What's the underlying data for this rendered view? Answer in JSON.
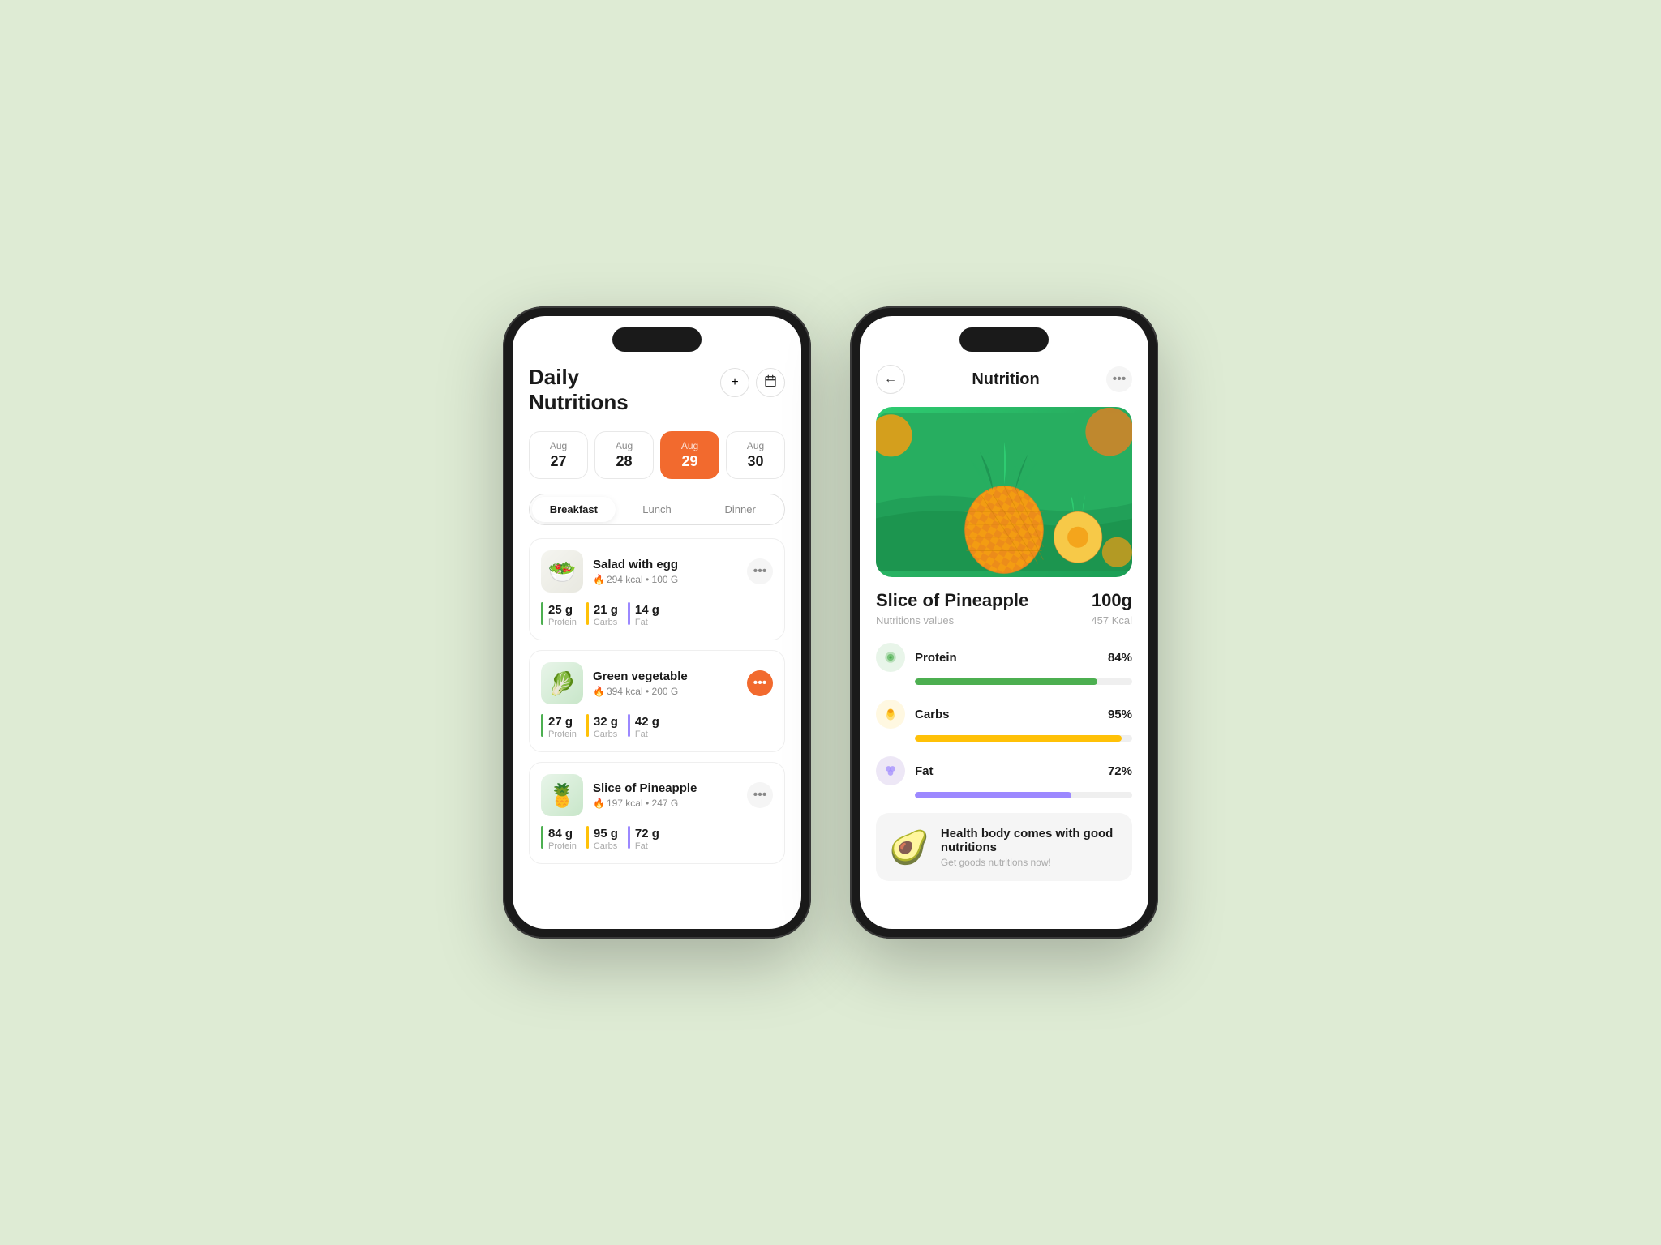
{
  "background": "#deebd4",
  "phone1": {
    "title": "Daily\nNutritions",
    "add_button": "+",
    "calendar_button": "📅",
    "dates": [
      {
        "month": "Aug",
        "day": "27",
        "active": false
      },
      {
        "month": "Aug",
        "day": "28",
        "active": false
      },
      {
        "month": "Aug",
        "day": "29",
        "active": true
      },
      {
        "month": "Aug",
        "day": "30",
        "active": false
      }
    ],
    "tabs": [
      {
        "label": "Breakfast",
        "active": true
      },
      {
        "label": "Lunch",
        "active": false
      },
      {
        "label": "Dinner",
        "active": false
      }
    ],
    "foods": [
      {
        "name": "Salad with egg",
        "kcal": "294 kcal",
        "weight": "100 G",
        "emoji": "🥗",
        "more_active": false,
        "nutrition": [
          {
            "value": "25 g",
            "label": "Protein",
            "color": "#4caf50"
          },
          {
            "value": "21 g",
            "label": "Carbs",
            "color": "#ffc107"
          },
          {
            "value": "14 g",
            "label": "Fat",
            "color": "#9c88ff"
          }
        ]
      },
      {
        "name": "Green vegetable",
        "kcal": "394 kcal",
        "weight": "200 G",
        "emoji": "🥬",
        "more_active": true,
        "nutrition": [
          {
            "value": "27 g",
            "label": "Protein",
            "color": "#4caf50"
          },
          {
            "value": "32 g",
            "label": "Carbs",
            "color": "#ffc107"
          },
          {
            "value": "42 g",
            "label": "Fat",
            "color": "#9c88ff"
          }
        ]
      },
      {
        "name": "Slice of Pineapple",
        "kcal": "197 kcal",
        "weight": "247 G",
        "emoji": "🍍",
        "more_active": false,
        "nutrition": [
          {
            "value": "84 g",
            "label": "Protein",
            "color": "#4caf50"
          },
          {
            "value": "95 g",
            "label": "Carbs",
            "color": "#ffc107"
          },
          {
            "value": "72 g",
            "label": "Fat",
            "color": "#9c88ff"
          }
        ]
      }
    ]
  },
  "phone2": {
    "title": "Nutrition",
    "back_label": "←",
    "more_label": "•••",
    "item_name": "Slice of Pineapple",
    "item_weight": "100g",
    "item_desc": "Nutritions values",
    "item_kcal": "457 Kcal",
    "nutrition_items": [
      {
        "label": "Protein",
        "pct": "84%",
        "fill": 84,
        "color": "#4caf50",
        "icon": "🫘",
        "icon_bg": "#e8f5e9"
      },
      {
        "label": "Carbs",
        "pct": "95%",
        "fill": 95,
        "color": "#ffc107",
        "icon": "🌽",
        "icon_bg": "#fff8e1"
      },
      {
        "label": "Fat",
        "pct": "72%",
        "fill": 72,
        "color": "#9c88ff",
        "icon": "🫐",
        "icon_bg": "#ede7f6"
      }
    ],
    "banner": {
      "title": "Health body comes with good nutritions",
      "subtitle": "Get goods nutritions now!",
      "emoji": "🥑"
    }
  }
}
